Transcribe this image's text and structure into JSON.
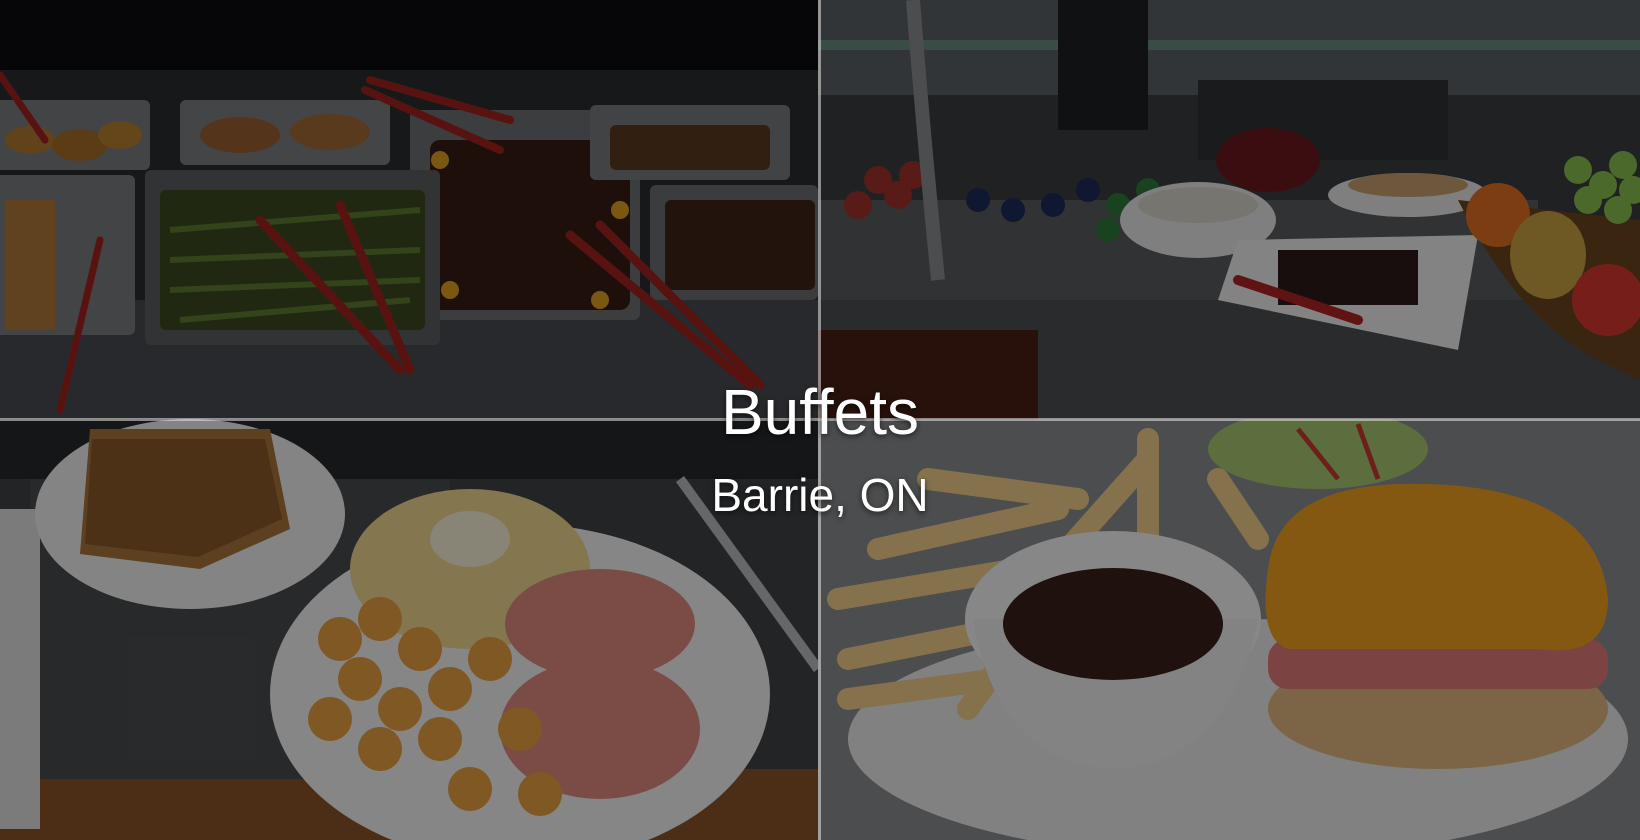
{
  "banner": {
    "title": "Buffets",
    "subtitle": "Barrie, ON"
  },
  "photos": {
    "top_left": "buffet-hot-trays",
    "top_right": "dessert-buffet-station",
    "bottom_left": "breakfast-plate",
    "bottom_right": "burger-fries-gravy"
  }
}
